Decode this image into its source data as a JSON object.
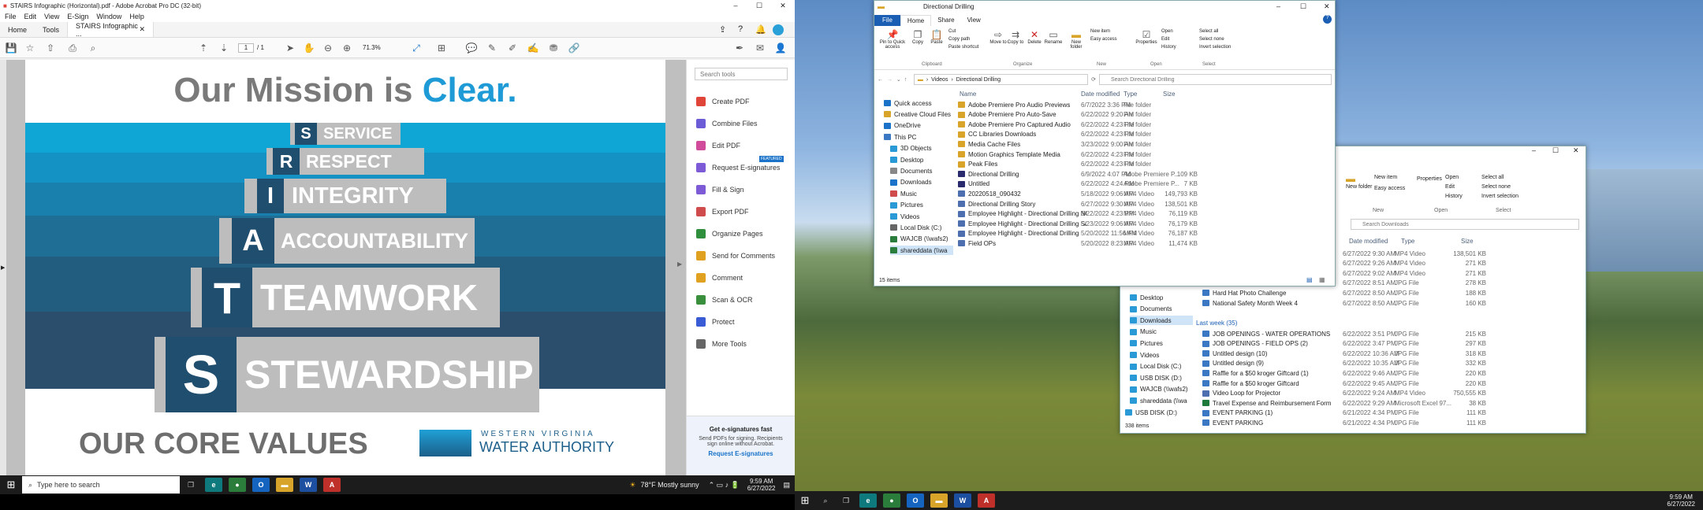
{
  "acrobat": {
    "window_title": "STAIRS Infographic (Horizontal).pdf - Adobe Acrobat Pro DC (32-bit)",
    "menu": [
      "File",
      "Edit",
      "View",
      "E-Sign",
      "Window",
      "Help"
    ],
    "tabs": {
      "home": "Home",
      "tools": "Tools",
      "doc": "STAIRS Infographic ..."
    },
    "page_current": "1",
    "page_total": "/ 1",
    "zoom": "71.3%",
    "search_tools_placeholder": "Search tools",
    "tools": [
      "Create PDF",
      "Combine Files",
      "Edit PDF",
      "Request E-signatures",
      "Fill & Sign",
      "Export PDF",
      "Organize Pages",
      "Send for Comments",
      "Comment",
      "Scan & OCR",
      "Protect",
      "More Tools"
    ],
    "tool_colors": [
      "#e0453a",
      "#6b5bd6",
      "#d04b9a",
      "#7d5bd6",
      "#7d5bd6",
      "#d04b4b",
      "#2f8f3c",
      "#e0a020",
      "#e0a020",
      "#3a8f3c",
      "#3a5bd6",
      "#666666"
    ],
    "featured_badge": "FEATURED",
    "esign_promo": {
      "title": "Get e-signatures fast",
      "body": "Send PDFs for signing. Recipients sign online without Acrobat.",
      "link": "Request E-signatures"
    }
  },
  "infographic": {
    "heading_part1": "Our Mission is ",
    "heading_part2": "Clear.",
    "steps": [
      {
        "letter": "S",
        "word": "SERVICE"
      },
      {
        "letter": "R",
        "word": "RESPECT"
      },
      {
        "letter": "I",
        "word": "INTEGRITY"
      },
      {
        "letter": "A",
        "word": "ACCOUNTABILITY"
      },
      {
        "letter": "T",
        "word": "TEAMWORK"
      },
      {
        "letter": "S",
        "word": "STEWARDSHIP"
      }
    ],
    "footer": "OUR CORE VALUES",
    "logo_line1": "WESTERN VIRGINIA",
    "logo_line2": "WATER AUTHORITY"
  },
  "explorer_front": {
    "title": "Directional Drilling",
    "ribbon_tabs": [
      "File",
      "Home",
      "Share",
      "View"
    ],
    "ribbon_buttons": [
      "Pin to Quick access",
      "Copy",
      "Paste",
      "Cut",
      "Copy path",
      "Paste shortcut",
      "Move to",
      "Copy to",
      "Delete",
      "Rename",
      "New folder",
      "New item",
      "Easy access",
      "Properties",
      "Open",
      "Edit",
      "History",
      "Select all",
      "Select none",
      "Invert selection"
    ],
    "ribbon_groups": [
      "Clipboard",
      "Organize",
      "New",
      "Open",
      "Select"
    ],
    "breadcrumb": [
      "Videos",
      "Directional Drilling"
    ],
    "search_placeholder": "Search Directional Drilling",
    "columns": [
      "Name",
      "Date modified",
      "Type",
      "Size"
    ],
    "nav": [
      "Quick access",
      "Creative Cloud Files",
      "OneDrive",
      "This PC",
      "3D Objects",
      "Desktop",
      "Documents",
      "Downloads",
      "Music",
      "Pictures",
      "Videos",
      "Local Disk (C:)",
      "WAJCB (\\\\wafs2)",
      "shareddata (\\\\wa"
    ],
    "files": [
      {
        "name": "Adobe Premiere Pro Audio Previews",
        "date": "6/7/2022 3:36 PM",
        "type": "File folder",
        "size": ""
      },
      {
        "name": "Adobe Premiere Pro Auto-Save",
        "date": "6/22/2022 9:20 AM",
        "type": "File folder",
        "size": ""
      },
      {
        "name": "Adobe Premiere Pro Captured Audio",
        "date": "6/22/2022 4:23 PM",
        "type": "File folder",
        "size": ""
      },
      {
        "name": "CC Libraries Downloads",
        "date": "6/22/2022 4:23 PM",
        "type": "File folder",
        "size": ""
      },
      {
        "name": "Media Cache Files",
        "date": "3/23/2022 9:00 AM",
        "type": "File folder",
        "size": ""
      },
      {
        "name": "Motion Graphics Template Media",
        "date": "6/22/2022 4:23 PM",
        "type": "File folder",
        "size": ""
      },
      {
        "name": "Peak Files",
        "date": "6/22/2022 4:23 PM",
        "type": "File folder",
        "size": ""
      },
      {
        "name": "Directional Drilling",
        "date": "6/9/2022 4:07 PM",
        "type": "Adobe Premiere P...",
        "size": "109 KB"
      },
      {
        "name": "Untitled",
        "date": "6/22/2022 4:24 PM",
        "type": "Adobe Premiere P...",
        "size": "7 KB"
      },
      {
        "name": "20220518_090432",
        "date": "5/18/2022 9:06 AM",
        "type": "MP4 Video",
        "size": "149,793 KB"
      },
      {
        "name": "Directional Drilling Story",
        "date": "6/27/2022 9:30 AM",
        "type": "MP4 Video",
        "size": "138,501 KB"
      },
      {
        "name": "Employee Highlight - Directional Drilling NO AUDIO",
        "date": "6/22/2022 4:23 PM",
        "type": "MP4 Video",
        "size": "76,119 KB"
      },
      {
        "name": "Employee Highlight - Directional Drilling Sub",
        "date": "5/23/2022 9:06 AM",
        "type": "MP4 Video",
        "size": "76,179 KB"
      },
      {
        "name": "Employee Highlight - Directional Drilling",
        "date": "5/20/2022 11:56 AM",
        "type": "MP4 Video",
        "size": "76,187 KB"
      },
      {
        "name": "Field OPs",
        "date": "5/20/2022 8:23 AM",
        "type": "MP4 Video",
        "size": "11,474 KB"
      }
    ],
    "status": "15 items"
  },
  "explorer_back": {
    "search_placeholder": "Search Downloads",
    "ribbon_buttons": [
      "New folder",
      "New item",
      "Easy access",
      "Properties",
      "Open",
      "Edit",
      "History",
      "Select all",
      "Select none",
      "Invert selection"
    ],
    "ribbon_groups": [
      "New",
      "Open",
      "Select"
    ],
    "columns": [
      "Date modified",
      "Type",
      "Size"
    ],
    "nav": [
      "Desktop",
      "Documents",
      "Downloads",
      "Music",
      "Pictures",
      "Videos",
      "Local Disk (C:)",
      "USB DISK (D:)",
      "WAJCB (\\\\wafs2)",
      "shareddata (\\\\wa",
      "USB DISK (D:)"
    ],
    "top_rows": [
      {
        "name": "",
        "date": "6/27/2022 9:30 AM",
        "type": "MP4 Video",
        "size": "138,501 KB"
      },
      {
        "name": "",
        "date": "6/27/2022 9:26 AM",
        "type": "MP4 Video",
        "size": "271 KB"
      },
      {
        "name": "",
        "date": "6/27/2022 9:02 AM",
        "type": "MP4 Video",
        "size": "271 KB"
      },
      {
        "name": "Water Mike 9",
        "date": "6/27/2022 8:51 AM",
        "type": "JPG File",
        "size": "278 KB"
      },
      {
        "name": "Hard Hat Photo Challenge",
        "date": "6/27/2022 8:50 AM",
        "type": "JPG File",
        "size": "188 KB"
      },
      {
        "name": "National Safety Month Week 4",
        "date": "6/27/2022 8:50 AM",
        "type": "JPG File",
        "size": "160 KB"
      }
    ],
    "group_label": "Last week (35)",
    "week_rows": [
      {
        "name": "JOB OPENINGS - WATER OPERATIONS (1)",
        "date": "6/22/2022 3:51 PM",
        "type": "JPG File",
        "size": "215 KB"
      },
      {
        "name": "JOB OPENINGS - FIELD OPS (2)",
        "date": "6/22/2022 3:47 PM",
        "type": "JPG File",
        "size": "297 KB"
      },
      {
        "name": "Untitled design (10)",
        "date": "6/22/2022 10:36 AM",
        "type": "JPG File",
        "size": "318 KB"
      },
      {
        "name": "Untitled design (9)",
        "date": "6/22/2022 10:35 AM",
        "type": "JPG File",
        "size": "332 KB"
      },
      {
        "name": "Raffle for a $50 kroger Giftcard (1)",
        "date": "6/22/2022 9:46 AM",
        "type": "JPG File",
        "size": "220 KB"
      },
      {
        "name": "Raffle for a $50 kroger Giftcard",
        "date": "6/22/2022 9:45 AM",
        "type": "JPG File",
        "size": "220 KB"
      },
      {
        "name": "Video Loop for Projector",
        "date": "6/22/2022 9:24 AM",
        "type": "MP4 Video",
        "size": "750,555 KB"
      },
      {
        "name": "Travel Expense and Reimbursement Form...",
        "date": "6/22/2022 9:29 AM",
        "type": "Microsoft Excel 97...",
        "size": "38 KB"
      },
      {
        "name": "EVENT PARKING (1)",
        "date": "6/21/2022 4:34 PM",
        "type": "JPG File",
        "size": "111 KB"
      },
      {
        "name": "EVENT PARKING",
        "date": "6/21/2022 4:34 PM",
        "type": "JPG File",
        "size": "111 KB"
      }
    ],
    "status": "338 items"
  },
  "taskbar_left": {
    "search_placeholder": "Type here to search",
    "weather": "78°F  Mostly sunny",
    "time": "9:59 AM",
    "date": "6/27/2022"
  },
  "taskbar_right": {
    "time": "9:59 AM",
    "date": "6/27/2022"
  }
}
